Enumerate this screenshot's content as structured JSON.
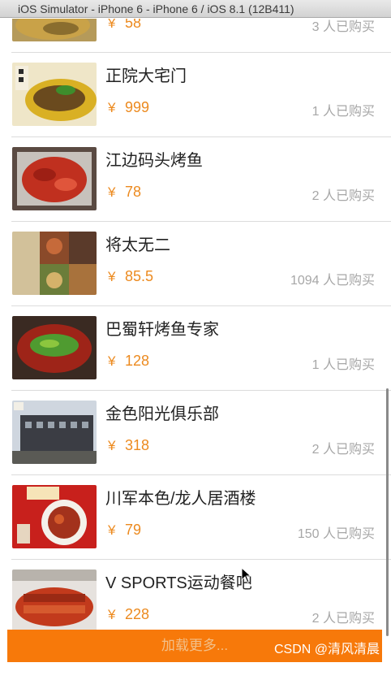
{
  "window": {
    "title": "iOS Simulator - iPhone 6 - iPhone 6 / iOS 8.1 (12B411)"
  },
  "currency_symbol": "¥",
  "deals": [
    {
      "name": "",
      "price": "58",
      "sold": "3 人已购买",
      "image": "food-photo"
    },
    {
      "name": "正院大宅门",
      "price": "999",
      "sold": "1 人已购买",
      "image": "fish-dish-photo"
    },
    {
      "name": "江边码头烤鱼",
      "price": "78",
      "sold": "2 人已购买",
      "image": "crayfish-photo"
    },
    {
      "name": "将太无二",
      "price": "85.5",
      "sold": "1094 人已购买",
      "image": "sushi-collage-photo"
    },
    {
      "name": "巴蜀轩烤鱼专家",
      "price": "128",
      "sold": "1 人已购买",
      "image": "grilled-fish-photo"
    },
    {
      "name": "金色阳光俱乐部",
      "price": "318",
      "sold": "2 人已购买",
      "image": "club-building-photo"
    },
    {
      "name": "川军本色/龙人居酒楼",
      "price": "79",
      "sold": "150 人已购买",
      "image": "restaurant-dish-photo"
    },
    {
      "name": "V SPORTS运动餐吧",
      "price": "228",
      "sold": "2 人已购买",
      "image": "ribs-photo"
    }
  ],
  "load_more": {
    "label": "加载更多..."
  },
  "watermark": "CSDN @清风清晨",
  "colors": {
    "accent": "#ec8a1f",
    "load_more_bg": "#f7790a",
    "sold_text": "#a7a7a7"
  }
}
